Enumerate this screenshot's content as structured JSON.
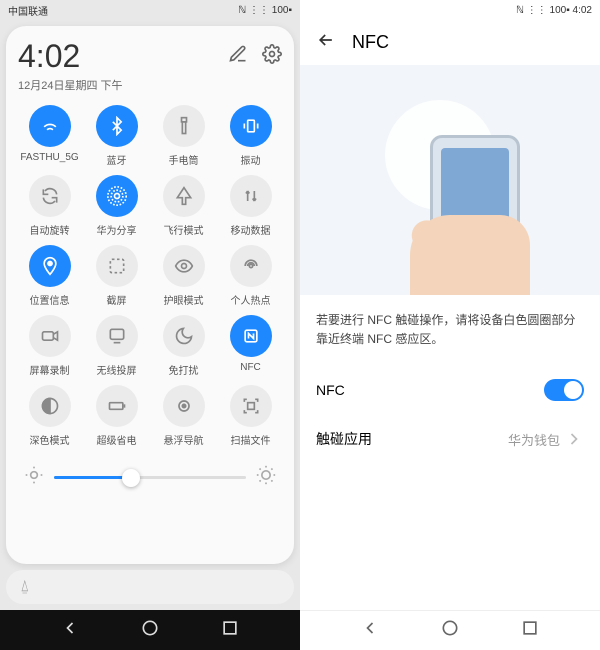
{
  "left": {
    "status": {
      "carrier": "中国联通",
      "icons": "ℕ ⋮⋮ 100▪"
    },
    "time": "4:02",
    "date": "12月24日星期四 下午",
    "tiles": [
      {
        "label": "FASTHU_5G",
        "icon": "wifi",
        "active": true
      },
      {
        "label": "蓝牙",
        "icon": "bluetooth",
        "active": true
      },
      {
        "label": "手电筒",
        "icon": "flashlight",
        "active": false
      },
      {
        "label": "振动",
        "icon": "vibrate",
        "active": true
      },
      {
        "label": "自动旋转",
        "icon": "rotate",
        "active": false
      },
      {
        "label": "华为分享",
        "icon": "share",
        "active": true
      },
      {
        "label": "飞行模式",
        "icon": "airplane",
        "active": false
      },
      {
        "label": "移动数据",
        "icon": "data",
        "active": false
      },
      {
        "label": "位置信息",
        "icon": "location",
        "active": true
      },
      {
        "label": "截屏",
        "icon": "screenshot",
        "active": false
      },
      {
        "label": "护眼模式",
        "icon": "eye",
        "active": false
      },
      {
        "label": "个人热点",
        "icon": "hotspot",
        "active": false
      },
      {
        "label": "屏幕录制",
        "icon": "record",
        "active": false
      },
      {
        "label": "无线投屏",
        "icon": "cast",
        "active": false
      },
      {
        "label": "免打扰",
        "icon": "dnd",
        "active": false
      },
      {
        "label": "NFC",
        "icon": "nfc",
        "active": true
      },
      {
        "label": "深色模式",
        "icon": "dark",
        "active": false
      },
      {
        "label": "超级省电",
        "icon": "battery",
        "active": false
      },
      {
        "label": "悬浮导航",
        "icon": "float",
        "active": false
      },
      {
        "label": "扫描文件",
        "icon": "scan",
        "active": false
      }
    ],
    "brightness": 40
  },
  "right": {
    "status": {
      "icons": "ℕ ⋮⋮ 100▪ 4:02"
    },
    "title": "NFC",
    "description": "若要进行 NFC 触碰操作，请将设备白色圆圈部分靠近终端 NFC 感应区。",
    "nfc_label": "NFC",
    "nfc_enabled": true,
    "touch_app_label": "触碰应用",
    "touch_app_value": "华为钱包"
  }
}
